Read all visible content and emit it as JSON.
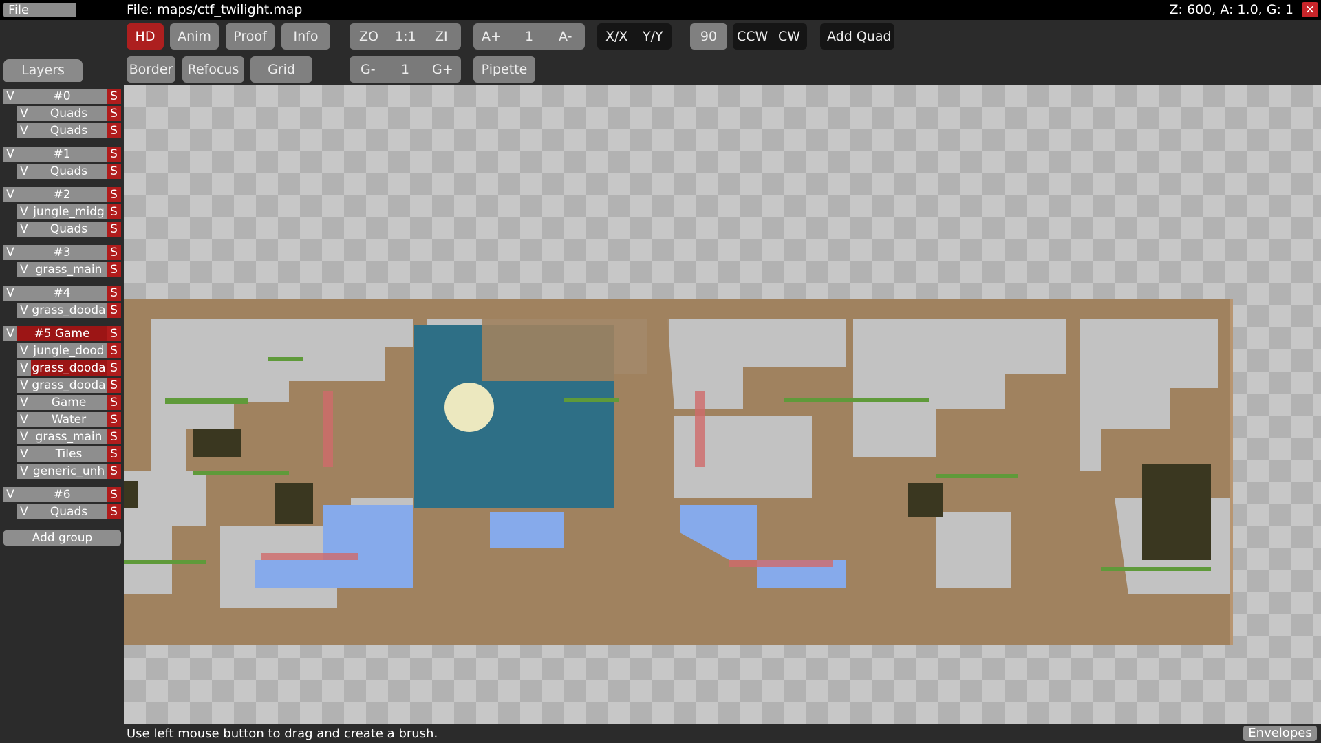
{
  "menu": {
    "file": "File"
  },
  "title": "File: maps/ctf_twilight.map",
  "status_right": "Z: 600, A: 1.0, G: 1",
  "close_icon": "×",
  "toolbar": {
    "hd": "HD",
    "anim": "Anim",
    "proof": "Proof",
    "info": "Info",
    "zo": "ZO",
    "one_one": "1:1",
    "zi": "ZI",
    "a_plus": "A+",
    "a_val": "1",
    "a_minus": "A-",
    "flip_x": "X/X",
    "flip_y": "Y/Y",
    "rot_val": "90",
    "ccw": "CCW",
    "cw": "CW",
    "add_quad": "Add Quad",
    "border": "Border",
    "refocus": "Refocus",
    "grid": "Grid",
    "g_minus": "G-",
    "g_val": "1",
    "g_plus": "G+",
    "pipette": "Pipette"
  },
  "sidebar": {
    "layers_tab": "Layers",
    "visible_flag": "V",
    "solo_flag": "S",
    "groups": [
      {
        "label": "#0",
        "layers": [
          "Quads",
          "Quads"
        ]
      },
      {
        "label": "#1",
        "layers": [
          "Quads"
        ]
      },
      {
        "label": "#2",
        "layers": [
          "jungle_midg",
          "Quads"
        ]
      },
      {
        "label": "#3",
        "layers": [
          "grass_main"
        ]
      },
      {
        "label": "#4",
        "layers": [
          "grass_dooda"
        ]
      },
      {
        "label": "#5 Game",
        "layers": [
          "jungle_dood",
          "grass_dooda",
          "grass_dooda",
          "Game",
          "Water",
          "grass_main",
          "Tiles",
          "generic_unh"
        ]
      },
      {
        "label": "#6",
        "layers": [
          "Quads"
        ]
      }
    ],
    "add_group": "Add group"
  },
  "statusbar": {
    "hint": "Use left mouse button to drag and create a brush.",
    "envelopes": "Envelopes"
  },
  "colors": {
    "accent_red": "#ad1f1f",
    "terrain": "#a0825f",
    "water": "#86aaeb",
    "grass": "#5f9a3a",
    "moon_sky": "#2e6f86"
  }
}
